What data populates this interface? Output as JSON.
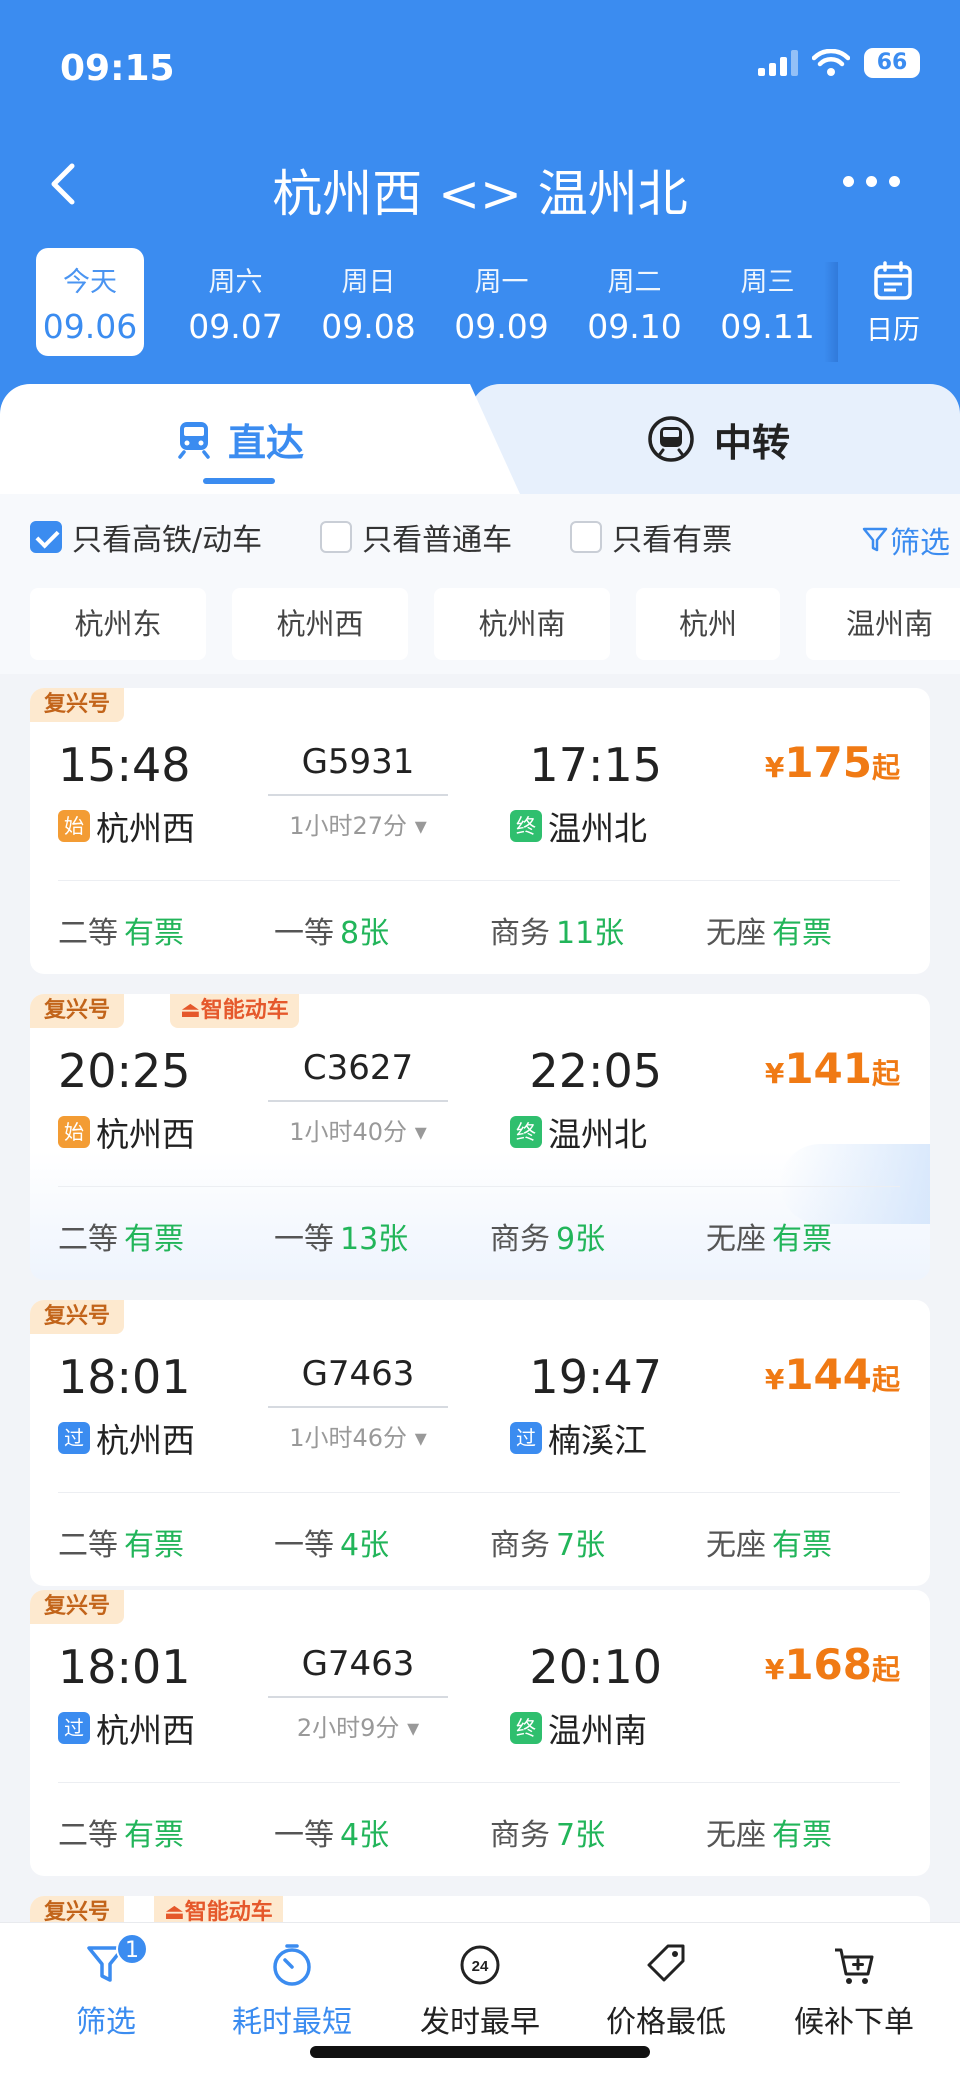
{
  "status": {
    "time": "09:15",
    "battery": "66"
  },
  "header": {
    "title": "杭州西 <> 温州北"
  },
  "dates": [
    {
      "dow": "今天",
      "day": "09.06"
    },
    {
      "dow": "周六",
      "day": "09.07"
    },
    {
      "dow": "周日",
      "day": "09.08"
    },
    {
      "dow": "周一",
      "day": "09.09"
    },
    {
      "dow": "周二",
      "day": "09.10"
    },
    {
      "dow": "周三",
      "day": "09.11"
    }
  ],
  "calendar_label": "日历",
  "tabs": {
    "direct": "直达",
    "transfer": "中转"
  },
  "filters": {
    "high_speed": "只看高铁/动车",
    "normal": "只看普通车",
    "available": "只看有票",
    "filter_link": "筛选",
    "filter_count": "1"
  },
  "stations": [
    "杭州东",
    "杭州西",
    "杭州南",
    "杭州",
    "温州南"
  ],
  "seat_labels": [
    "二等",
    "一等",
    "商务",
    "无座"
  ],
  "trains": [
    {
      "tag": "复兴号",
      "tag2": "",
      "dep": "15:48",
      "arr": "17:15",
      "no": "G5931",
      "dur": "1小时27分",
      "from_type": "始",
      "from": "杭州西",
      "to_type": "终",
      "to": "温州北",
      "price": "175",
      "seats": [
        "有票",
        "8张",
        "11张",
        "有票"
      ]
    },
    {
      "tag": "复兴号",
      "tag2": "智能动车",
      "dep": "20:25",
      "arr": "22:05",
      "no": "C3627",
      "dur": "1小时40分",
      "from_type": "始",
      "from": "杭州西",
      "to_type": "终",
      "to": "温州北",
      "price": "141",
      "seats": [
        "有票",
        "13张",
        "9张",
        "有票"
      ]
    },
    {
      "tag": "复兴号",
      "tag2": "",
      "dep": "18:01",
      "arr": "19:47",
      "no": "G7463",
      "dur": "1小时46分",
      "from_type": "过",
      "from": "杭州西",
      "to_type": "过",
      "to": "楠溪江",
      "price": "144",
      "seats": [
        "有票",
        "4张",
        "7张",
        "有票"
      ]
    },
    {
      "tag": "复兴号",
      "tag2": "",
      "dep": "18:01",
      "arr": "20:10",
      "no": "G7463",
      "dur": "2小时9分",
      "from_type": "过",
      "from": "杭州西",
      "to_type": "终",
      "to": "温州南",
      "price": "168",
      "seats": [
        "有票",
        "4张",
        "7张",
        "有票"
      ]
    },
    {
      "tag": "复兴号",
      "tag2": "智能动车"
    }
  ],
  "price_currency": "¥",
  "price_suffix": "起",
  "bottom": {
    "filter": "筛选",
    "filter_count": "1",
    "shortest": "耗时最短",
    "earliest": "发时最早",
    "cheapest": "价格最低",
    "waitlist": "候补下单",
    "earliest_icon_text": "24"
  }
}
